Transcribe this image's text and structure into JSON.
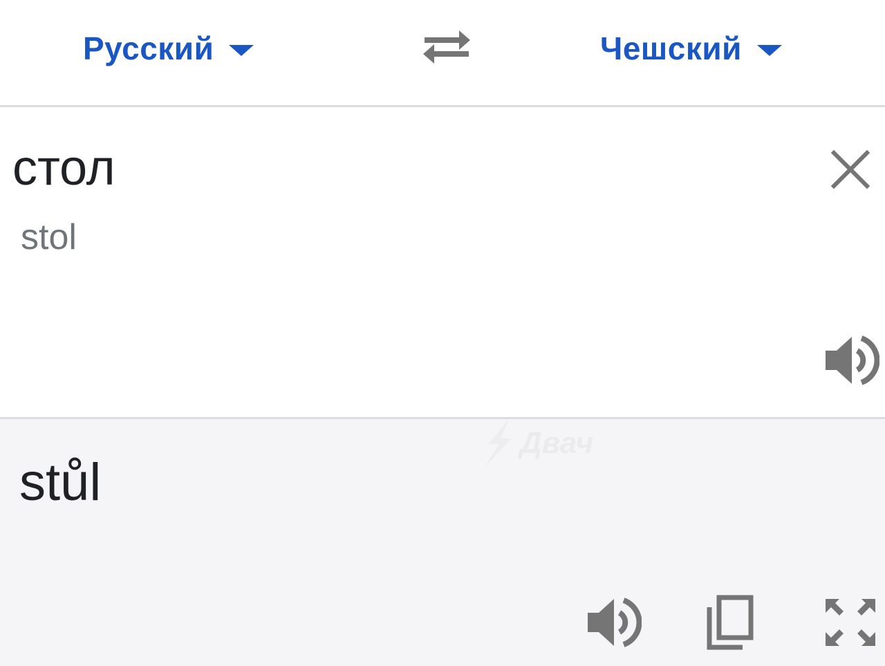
{
  "header": {
    "source_language": "Русский",
    "target_language": "Чешский",
    "swap_icon": "swap-arrows-icon"
  },
  "source": {
    "text": "стол",
    "transliteration": "stol",
    "clear_icon": "close-icon",
    "speak_icon": "speaker-icon"
  },
  "target": {
    "text": "stůl",
    "speak_icon": "speaker-icon",
    "copy_icon": "copy-icon",
    "expand_icon": "fullscreen-icon"
  },
  "watermark": {
    "text": "Двач"
  },
  "colors": {
    "accent": "#1a57c2",
    "icon": "#757575",
    "target_bg": "#f5f5f7",
    "divider": "#dadce0"
  }
}
